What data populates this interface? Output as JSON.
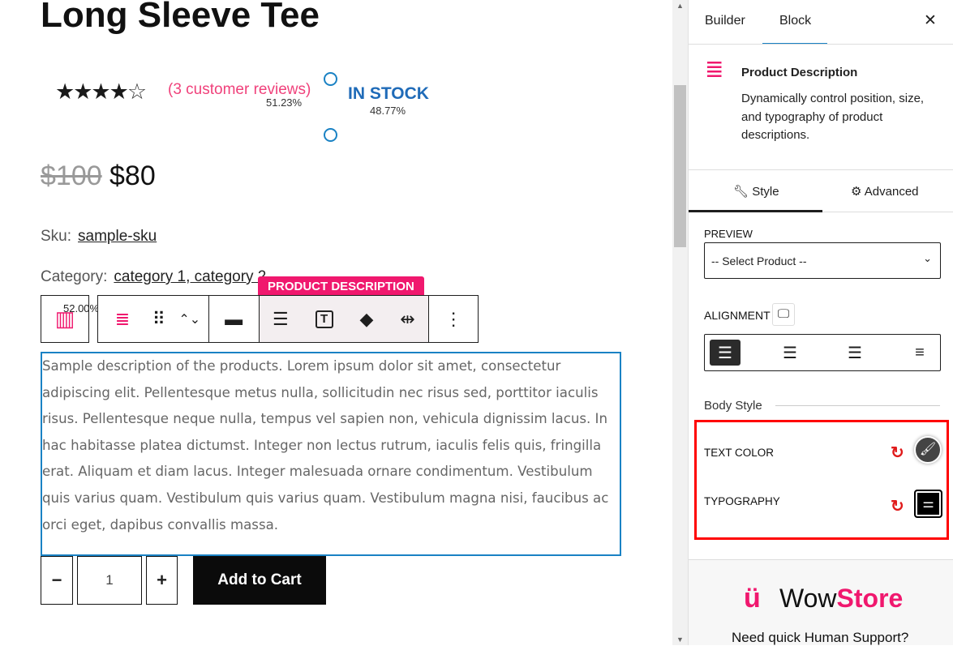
{
  "product": {
    "title": "Long Sleeve Tee",
    "rating_stars": "★★★★",
    "rating_empty": "☆",
    "rating_value": 4,
    "reviews": "(3 customer reviews)",
    "stock": "IN STOCK",
    "width_left": "51.23%",
    "width_right": "48.77%",
    "old_price": "$100",
    "price": "$80",
    "sku_label": "Sku:",
    "sku": "sample-sku",
    "category_label": "Category:",
    "categories": "category 1, category 2",
    "description": "Sample description of the products. Lorem ipsum dolor sit amet, consectetur adipiscing elit. Pellentesque metus nulla, sollicitudin nec risus sed, porttitor iaculis risus. Pellentesque neque nulla, tempus vel sapien non, vehicula dignissim lacus. In hac habitasse platea dictumst. Integer non lectus rutrum, iaculis felis quis, fringilla erat. Aliquam et diam lacus. Integer malesuada ornare condimentum. Vestibulum quis varius quam. Vestibulum quis varius quam. Vestibulum magna nisi, faucibus ac orci eget, dapibus convallis massa.",
    "quantity": "1",
    "minus": "−",
    "plus": "+",
    "add_to_cart": "Add to Cart"
  },
  "toolbar": {
    "label": "PRODUCT DESCRIPTION",
    "column_width": "52.00%",
    "more": "⋮"
  },
  "panel": {
    "tabs": [
      "Builder",
      "Block"
    ],
    "active_tab": "Block",
    "close": "✕",
    "block_title": "Product Description",
    "block_desc": "Dynamically control position, size, and typography of product descriptions.",
    "subtabs": [
      "Style",
      "Advanced"
    ],
    "active_subtab": "Style",
    "preview_label": "PREVIEW",
    "preview_value": "-- Select Product --",
    "alignment_label": "ALIGNMENT",
    "alignment_selected": "left",
    "section": "Body Style",
    "text_color_label": "TEXT COLOR",
    "typography_label": "TYPOGRAPHY",
    "brand_a": "Wow",
    "brand_b": "Store",
    "support": "Need quick Human Support?"
  },
  "colors": {
    "accent": "#f0186e",
    "selection": "#1a82c4",
    "highlight": "#ff0000"
  }
}
